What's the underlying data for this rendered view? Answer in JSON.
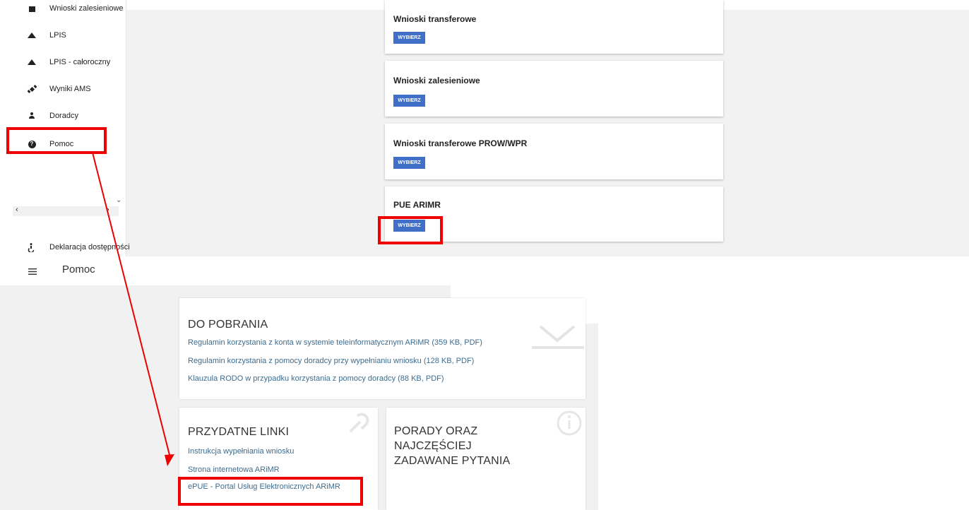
{
  "sidebar": {
    "items": [
      {
        "label": "Wnioski zalesieniowe",
        "icon": "document-icon"
      },
      {
        "label": "LPIS",
        "icon": "mountain-icon"
      },
      {
        "label": "LPIS - całoroczny",
        "icon": "mountain-icon"
      },
      {
        "label": "Wyniki AMS",
        "icon": "satellite-icon"
      },
      {
        "label": "Doradcy",
        "icon": "person-icon"
      },
      {
        "label": "Pomoc",
        "icon": "help-circle-icon"
      }
    ],
    "accessibility_label": "Deklaracja dostępności"
  },
  "cards": [
    {
      "title": "Wnioski transferowe",
      "button": "WYBIERZ"
    },
    {
      "title": "Wnioski zalesieniowe",
      "button": "WYBIERZ"
    },
    {
      "title": "Wnioski transferowe PROW/WPR",
      "button": "WYBIERZ"
    },
    {
      "title": "PUE ARIMR",
      "button": "WYBIERZ"
    }
  ],
  "help_header": {
    "title": "Pomoc"
  },
  "downloads": {
    "title": "DO POBRANIA",
    "links": [
      "Regulamin korzystania z konta w systemie teleinformatycznym ARiMR (359 KB, PDF)",
      "Regulamin korzystania z pomocy doradcy przy wypełnianiu wniosku (128 KB, PDF)",
      "Klauzula RODO w przypadku korzystania z pomocy doradcy (88 KB, PDF)"
    ]
  },
  "useful_links": {
    "title": "PRZYDATNE LINKI",
    "links": [
      "Instrukcja wypełniania wniosku",
      "Strona internetowa ARiMR",
      "ePUE - Portal Usług Elektronicznych ARiMR"
    ]
  },
  "faq": {
    "title_line1": "PORADY ORAZ",
    "title_line2": "NAJCZĘŚCIEJ",
    "title_line3": "ZADAWANE PYTANIA"
  },
  "colors": {
    "button": "#3f6fc6",
    "link": "#3d6c8e",
    "highlight": "#ee0000",
    "background": "#f2f2f2"
  }
}
